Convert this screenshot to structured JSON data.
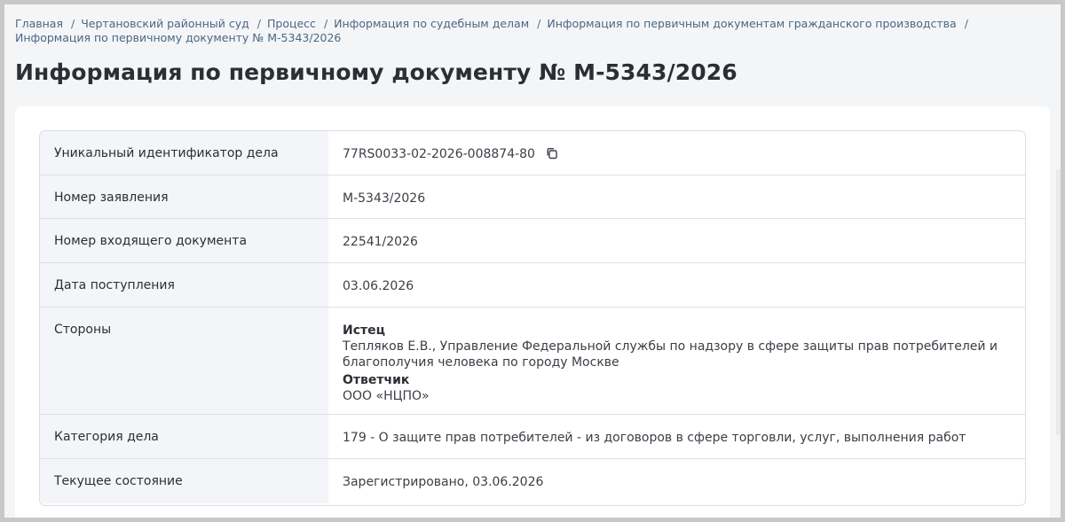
{
  "breadcrumb": [
    {
      "label": "Главная"
    },
    {
      "label": "Чертановский районный суд"
    },
    {
      "label": "Процесс"
    },
    {
      "label": "Информация по судебным делам"
    },
    {
      "label": "Информация по первичным документам гражданского производства"
    },
    {
      "label": "Информация по первичному документу № М-5343/2026"
    }
  ],
  "page": {
    "title": "Информация по первичному документу № М-5343/2026"
  },
  "details": {
    "uid_label": "Уникальный идентификатор дела",
    "uid_value": "77RS0033-02-2026-008874-80",
    "application_label": "Номер заявления",
    "application_value": "М-5343/2026",
    "incoming_label": "Номер входящего документа",
    "incoming_value": "22541/2026",
    "received_label": "Дата поступления",
    "received_value": "03.06.2026",
    "parties_label": "Стороны",
    "parties": {
      "plaintiff_role": "Истец",
      "plaintiff_name": "Тепляков Е.В., Управление Федеральной службы по надзору в сфере защиты прав потребителей и благополучия человека по городу Москве",
      "defendant_role": "Ответчик",
      "defendant_name": "ООО «НЦПО»"
    },
    "category_label": "Категория дела",
    "category_value": "179 - О защите прав потребителей - из договоров в сфере торговли, услуг, выполнения работ",
    "status_label": "Текущее состояние",
    "status_value": "Зарегистрировано, 03.06.2026"
  },
  "icons": {
    "copy": "copy-icon"
  },
  "colors": {
    "link": "#4a6784",
    "title": "#2b2f35",
    "label_bg": "#f3f5f8",
    "border": "#d9dee5"
  }
}
